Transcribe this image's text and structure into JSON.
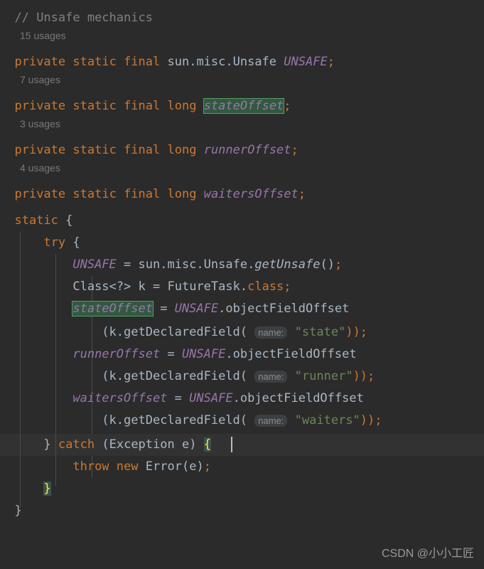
{
  "editor": {
    "background": "#2b2b2b",
    "current_line_background": "#323232",
    "font_size_px": 17,
    "line_height_px": 31,
    "colors": {
      "default_text": "#a9b7c6",
      "keyword": "#cc7832",
      "comment": "#808080",
      "string": "#6a8759",
      "static_field": "#9876aa",
      "inlay_hint": "#8c8c8c",
      "usages_hint": "#787878",
      "identifier_highlight_bg": "#31593f",
      "identifier_highlight_border": "#5a9b6e",
      "matched_brace_bg": "#3b514d",
      "matched_brace_fg": "#ffef28",
      "indent_guide": "#4b4b4b",
      "caret": "#bbbbbb"
    }
  },
  "code": {
    "comment_line": "// Unsafe mechanics",
    "usages": {
      "unsafe": "15 usages",
      "state_offset": "7 usages",
      "runner_offset": "3 usages",
      "waiters_offset": "4 usages"
    },
    "tokens": {
      "kw_private": "private",
      "kw_static": "static",
      "kw_final": "final",
      "kw_long": "long",
      "kw_try": "try",
      "kw_catch": "catch",
      "kw_class": "class",
      "kw_throw": "throw",
      "kw_new": "new",
      "type_unsafe_fqn": "sun.misc.Unsafe",
      "field_unsafe": "UNSAFE",
      "field_state_offset": "stateOffset",
      "field_runner_offset": "runnerOffset",
      "field_waiters_offset": "waitersOffset",
      "type_class_wildcard": "Class<?>",
      "var_k": "k",
      "type_future_task": "FutureTask",
      "method_get_unsafe": "getUnsafe",
      "method_object_field_offset": "objectFieldOffset",
      "method_get_declared_field": "k.getDeclaredField",
      "type_exception": "Exception",
      "var_e": "e",
      "type_error": "Error",
      "str_state": "\"state\"",
      "str_runner": "\"runner\"",
      "str_waiters": "\"waiters\"",
      "hint_name": "name:",
      "eq": "=",
      "semi": ";",
      "brace_open": "{",
      "brace_close": "}",
      "paren_open": "(",
      "paren_close": ")",
      "dot": ".",
      "close_paren_paren_semi": "));"
    },
    "lines": [
      "// Unsafe mechanics",
      "private static final sun.misc.Unsafe UNSAFE;",
      "private static final long stateOffset;",
      "private static final long runnerOffset;",
      "private static final long waitersOffset;",
      "static {",
      "    try {",
      "        UNSAFE = sun.misc.Unsafe.getUnsafe();",
      "        Class<?> k = FutureTask.class;",
      "        stateOffset = UNSAFE.objectFieldOffset",
      "            (k.getDeclaredField( name: \"state\"));",
      "        runnerOffset = UNSAFE.objectFieldOffset",
      "            (k.getDeclaredField( name: \"runner\"));",
      "        waitersOffset = UNSAFE.objectFieldOffset",
      "            (k.getDeclaredField( name: \"waiters\"));",
      "    } catch (Exception e) {",
      "        throw new Error(e);",
      "    }",
      "}"
    ]
  },
  "watermark": {
    "text": "CSDN @小小工匠"
  }
}
